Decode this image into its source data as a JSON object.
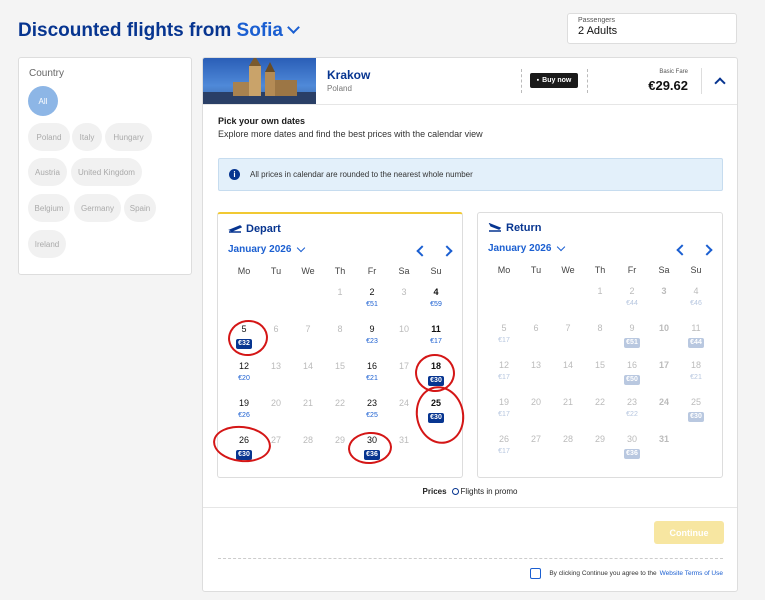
{
  "header": {
    "title_prefix": "Discounted flights from",
    "city": "Sofia",
    "passengers_label": "Passengers",
    "passengers_value": "2 Adults"
  },
  "filters": {
    "heading": "Country",
    "chips": [
      "All",
      "Poland",
      "Italy",
      "Hungary",
      "Austria",
      "United Kingdom",
      "Belgium",
      "Germany",
      "Spain",
      "Ireland"
    ]
  },
  "destination": {
    "name": "Krakow",
    "country": "Poland",
    "buy_label": "Buy now",
    "fare_label": "Basic Fare",
    "fare_value": "€29.62"
  },
  "intro": {
    "title": "Pick your own dates",
    "subtitle": "Explore more dates and find the best prices with the calendar view"
  },
  "notice": "All prices in calendar are rounded to the nearest whole number",
  "weekdays": [
    "Mo",
    "Tu",
    "We",
    "Th",
    "Fr",
    "Sa",
    "Su"
  ],
  "depart": {
    "title": "Depart",
    "month": "January 2026",
    "days": [
      {
        "d": "1",
        "p": "",
        "s": "dim"
      },
      {
        "d": "2",
        "p": "€51",
        "s": "avail"
      },
      {
        "d": "3",
        "p": "",
        "s": "dim"
      },
      {
        "d": "4",
        "p": "€59",
        "s": "avail bold"
      },
      {
        "d": "5",
        "p": "€32",
        "s": "avail promo"
      },
      {
        "d": "6",
        "p": "",
        "s": "dim"
      },
      {
        "d": "7",
        "p": "",
        "s": "dim"
      },
      {
        "d": "8",
        "p": "",
        "s": "dim"
      },
      {
        "d": "9",
        "p": "€23",
        "s": "avail"
      },
      {
        "d": "10",
        "p": "",
        "s": "dim"
      },
      {
        "d": "11",
        "p": "€17",
        "s": "avail bold"
      },
      {
        "d": "12",
        "p": "€20",
        "s": "avail"
      },
      {
        "d": "13",
        "p": "",
        "s": "dim"
      },
      {
        "d": "14",
        "p": "",
        "s": "dim"
      },
      {
        "d": "15",
        "p": "",
        "s": "dim"
      },
      {
        "d": "16",
        "p": "€21",
        "s": "avail"
      },
      {
        "d": "17",
        "p": "",
        "s": "dim"
      },
      {
        "d": "18",
        "p": "€30",
        "s": "avail bold promo"
      },
      {
        "d": "19",
        "p": "€26",
        "s": "avail"
      },
      {
        "d": "20",
        "p": "",
        "s": "dim"
      },
      {
        "d": "21",
        "p": "",
        "s": "dim"
      },
      {
        "d": "22",
        "p": "",
        "s": "dim"
      },
      {
        "d": "23",
        "p": "€25",
        "s": "avail"
      },
      {
        "d": "24",
        "p": "",
        "s": "dim"
      },
      {
        "d": "25",
        "p": "€30",
        "s": "avail bold promo"
      },
      {
        "d": "26",
        "p": "€30",
        "s": "avail promo"
      },
      {
        "d": "27",
        "p": "",
        "s": "dim"
      },
      {
        "d": "28",
        "p": "",
        "s": "dim"
      },
      {
        "d": "29",
        "p": "",
        "s": "dim"
      },
      {
        "d": "30",
        "p": "€36",
        "s": "avail promo"
      },
      {
        "d": "31",
        "p": "",
        "s": "dim"
      }
    ]
  },
  "return": {
    "title": "Return",
    "month": "January 2026",
    "days": [
      {
        "d": "1",
        "p": "",
        "s": "dim"
      },
      {
        "d": "2",
        "p": "€44",
        "s": "dim"
      },
      {
        "d": "3",
        "p": "",
        "s": "dim bold"
      },
      {
        "d": "4",
        "p": "€46",
        "s": "dim"
      },
      {
        "d": "5",
        "p": "€17",
        "s": "dim"
      },
      {
        "d": "6",
        "p": "",
        "s": "dim"
      },
      {
        "d": "7",
        "p": "",
        "s": "dim"
      },
      {
        "d": "8",
        "p": "",
        "s": "dim"
      },
      {
        "d": "9",
        "p": "€51",
        "s": "dim promo"
      },
      {
        "d": "10",
        "p": "",
        "s": "dim bold"
      },
      {
        "d": "11",
        "p": "€44",
        "s": "dim promo"
      },
      {
        "d": "12",
        "p": "€17",
        "s": "dim"
      },
      {
        "d": "13",
        "p": "",
        "s": "dim"
      },
      {
        "d": "14",
        "p": "",
        "s": "dim"
      },
      {
        "d": "15",
        "p": "",
        "s": "dim"
      },
      {
        "d": "16",
        "p": "€50",
        "s": "dim promo"
      },
      {
        "d": "17",
        "p": "",
        "s": "dim bold"
      },
      {
        "d": "18",
        "p": "€21",
        "s": "dim"
      },
      {
        "d": "19",
        "p": "€17",
        "s": "dim"
      },
      {
        "d": "20",
        "p": "",
        "s": "dim"
      },
      {
        "d": "21",
        "p": "",
        "s": "dim"
      },
      {
        "d": "22",
        "p": "",
        "s": "dim"
      },
      {
        "d": "23",
        "p": "€22",
        "s": "dim"
      },
      {
        "d": "24",
        "p": "",
        "s": "dim bold"
      },
      {
        "d": "25",
        "p": "€30",
        "s": "dim promo"
      },
      {
        "d": "26",
        "p": "€17",
        "s": "dim"
      },
      {
        "d": "27",
        "p": "",
        "s": "dim"
      },
      {
        "d": "28",
        "p": "",
        "s": "dim"
      },
      {
        "d": "29",
        "p": "",
        "s": "dim"
      },
      {
        "d": "30",
        "p": "€36",
        "s": "dim promo"
      },
      {
        "d": "31",
        "p": "",
        "s": "dim bold"
      }
    ]
  },
  "legend": {
    "label": "Prices",
    "option": "Flights in promo"
  },
  "footer": {
    "continue_label": "Continue",
    "terms_text": "By clicking Continue you agree to the",
    "terms_link": "Website Terms of Use"
  },
  "colors": {
    "brand": "#073590",
    "accent": "#1b5fd1",
    "highlight": "#f1c933",
    "annotation": "#d41616"
  }
}
